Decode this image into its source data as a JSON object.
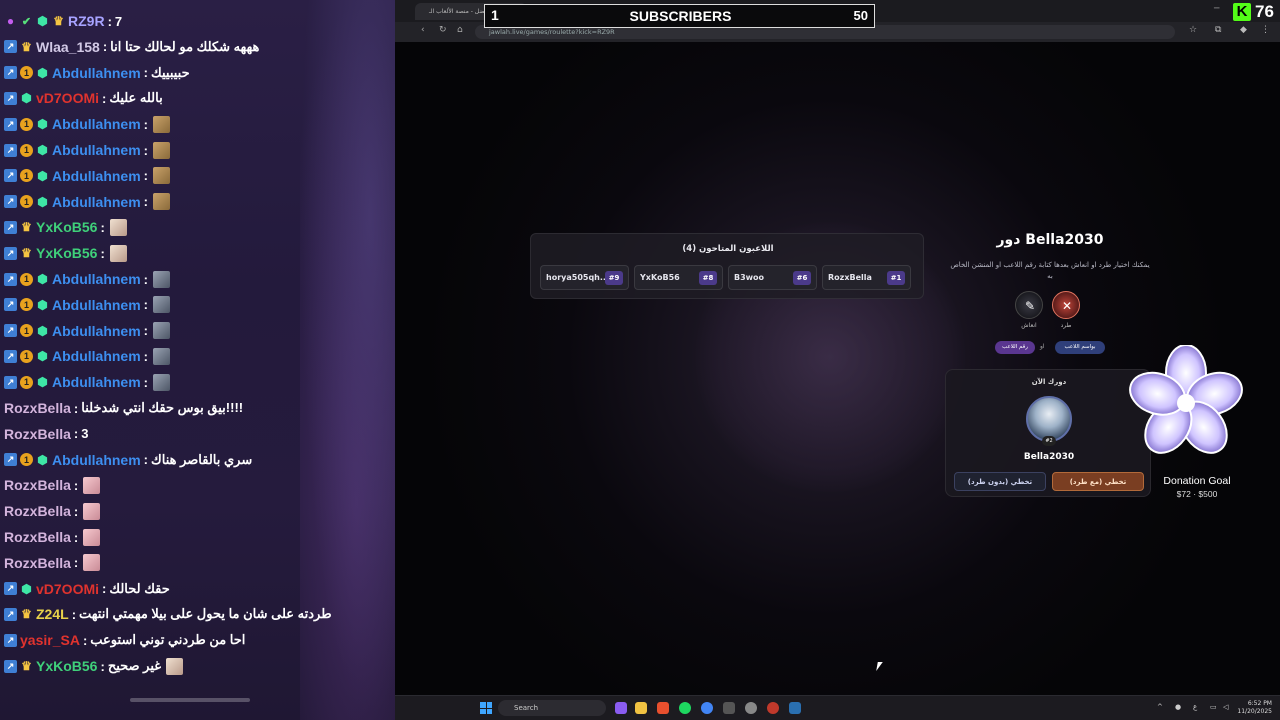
{
  "chat": {
    "rows": [
      {
        "badges": [
          "mic",
          "check",
          "mod",
          "crown"
        ],
        "user": "RZ9R",
        "color": "#a7a3ff",
        "sep": " : ",
        "text": "7",
        "emote": ""
      },
      {
        "badges": [
          "sub",
          "crown"
        ],
        "user": "Wlaa_158",
        "color": "#d2c9e6",
        "sep": " : ",
        "text": "هههه شكلك مو لحالك حتا انا",
        "emote": ""
      },
      {
        "badges": [
          "sub",
          "one",
          "mod"
        ],
        "user": "Abdullahnem",
        "color": "#3d8ff0",
        "sep": " : ",
        "text": "حبيبييك",
        "emote": ""
      },
      {
        "badges": [
          "sub",
          "mod"
        ],
        "user": "vD7OOMi",
        "color": "#e0332e",
        "sep": " : ",
        "text": "بالله عليك",
        "emote": ""
      },
      {
        "badges": [
          "sub",
          "one",
          "mod"
        ],
        "user": "Abdullahnem",
        "color": "#3d8ff0",
        "sep": " : ",
        "text": "",
        "emote": "cat"
      },
      {
        "badges": [
          "sub",
          "one",
          "mod"
        ],
        "user": "Abdullahnem",
        "color": "#3d8ff0",
        "sep": " : ",
        "text": "",
        "emote": "cat"
      },
      {
        "badges": [
          "sub",
          "one",
          "mod"
        ],
        "user": "Abdullahnem",
        "color": "#3d8ff0",
        "sep": " : ",
        "text": "",
        "emote": "cat"
      },
      {
        "badges": [
          "sub",
          "one",
          "mod"
        ],
        "user": "Abdullahnem",
        "color": "#3d8ff0",
        "sep": " : ",
        "text": "",
        "emote": "cat"
      },
      {
        "badges": [
          "sub",
          "crown"
        ],
        "user": "YxKoB56",
        "color": "#3fd07a",
        "sep": " : ",
        "text": "",
        "emote": "face"
      },
      {
        "badges": [
          "sub",
          "crown"
        ],
        "user": "YxKoB56",
        "color": "#3fd07a",
        "sep": " : ",
        "text": "",
        "emote": "face"
      },
      {
        "badges": [
          "sub",
          "one",
          "mod"
        ],
        "user": "Abdullahnem",
        "color": "#3d8ff0",
        "sep": " : ",
        "text": "",
        "emote": "gun"
      },
      {
        "badges": [
          "sub",
          "one",
          "mod"
        ],
        "user": "Abdullahnem",
        "color": "#3d8ff0",
        "sep": " : ",
        "text": "",
        "emote": "gun"
      },
      {
        "badges": [
          "sub",
          "one",
          "mod"
        ],
        "user": "Abdullahnem",
        "color": "#3d8ff0",
        "sep": " : ",
        "text": "",
        "emote": "gun"
      },
      {
        "badges": [
          "sub",
          "one",
          "mod"
        ],
        "user": "Abdullahnem",
        "color": "#3d8ff0",
        "sep": " : ",
        "text": "",
        "emote": "gun"
      },
      {
        "badges": [
          "sub",
          "one",
          "mod"
        ],
        "user": "Abdullahnem",
        "color": "#3d8ff0",
        "sep": " : ",
        "text": "",
        "emote": "gun"
      },
      {
        "badges": [],
        "user": "RozxBella",
        "color": "#d3b4dc",
        "sep": " : ",
        "text": "بيق بوس حقك انتي شدخلنا!!!!",
        "emote": ""
      },
      {
        "badges": [],
        "user": "RozxBella",
        "color": "#d3b4dc",
        "sep": " : ",
        "text": "3",
        "emote": ""
      },
      {
        "badges": [
          "sub",
          "one",
          "mod"
        ],
        "user": "Abdullahnem",
        "color": "#3d8ff0",
        "sep": " : ",
        "text": "سري بالقاصر هناك",
        "emote": ""
      },
      {
        "badges": [],
        "user": "RozxBella",
        "color": "#d3b4dc",
        "sep": " : ",
        "text": "",
        "emote": "pink"
      },
      {
        "badges": [],
        "user": "RozxBella",
        "color": "#d3b4dc",
        "sep": " : ",
        "text": "",
        "emote": "pink"
      },
      {
        "badges": [],
        "user": "RozxBella",
        "color": "#d3b4dc",
        "sep": " : ",
        "text": "",
        "emote": "pink"
      },
      {
        "badges": [],
        "user": "RozxBella",
        "color": "#d3b4dc",
        "sep": " : ",
        "text": "",
        "emote": "pink"
      },
      {
        "badges": [
          "sub",
          "mod"
        ],
        "user": "vD7OOMi",
        "color": "#e0332e",
        "sep": " : ",
        "text": "حقك لحالك",
        "emote": ""
      },
      {
        "badges": [
          "sub",
          "crown"
        ],
        "user": "Z24L",
        "color": "#e8d24a",
        "sep": " : ",
        "text": "طردته على شان ما يحول على بيلا مهمتي انتهت",
        "emote": ""
      },
      {
        "badges": [
          "sub"
        ],
        "user": "yasir_SA",
        "color": "#e0332e",
        "sep": " : ",
        "text": "احا من طردني توني استوعب",
        "emote": ""
      },
      {
        "badges": [
          "sub",
          "crown"
        ],
        "user": "YxKoB56",
        "color": "#3fd07a",
        "sep": " : ",
        "text": "غير صحيح",
        "emote": "face"
      }
    ]
  },
  "browser": {
    "tab_title": "جولة أفضل - منصة الألعاب الـ",
    "url": "jawlah.live/games/roulette?kick=RZ9R"
  },
  "game": {
    "players_title": "اللاعبون المتاحون (4)",
    "players": [
      {
        "name": "horya505qh...",
        "num": "#9"
      },
      {
        "name": "YxKoB56",
        "num": "#8"
      },
      {
        "name": "B3woo",
        "num": "#6"
      },
      {
        "name": "RozxBella",
        "num": "#1"
      }
    ],
    "turn_title": "دور Bella2030",
    "turn_desc": "يمكنك اختيار طرد او انعاش بعدها كتابة رقم اللاعب او المنشن الخاص به",
    "action_kick_label": "طرد",
    "action_bribe_label": "انعاش",
    "pill_mention": "بواسم اللاعب",
    "pill_or": "او",
    "pill_number": "رقم اللاعب",
    "now_label": "دورك الآن",
    "now_badge": "#2",
    "now_name": "Bella2030",
    "btn_skip_nokick": "تخطي (بدون طرد)",
    "btn_skip_kick": "تخطي (مع طرد)"
  },
  "overlay": {
    "subs_left": "1",
    "subs_label": "SUBSCRIBERS",
    "subs_right": "50",
    "kick_logo": "K",
    "kick_count": "76",
    "goal_title": "Donation Goal",
    "goal_value": "$72 · $500"
  },
  "taskbar": {
    "search": "Search",
    "time": "6:52 PM",
    "date": "11/20/2025"
  },
  "colors": {
    "accent_purple": "#4b3a8a",
    "kick_green": "#53fc18",
    "kick_button": "#7a3e22"
  }
}
